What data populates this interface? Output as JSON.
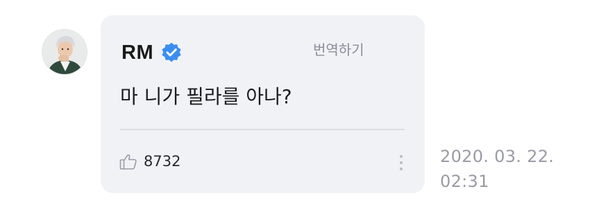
{
  "comment": {
    "author": "RM",
    "verified": true,
    "translate_label": "번역하기",
    "text": "마 니가 필라를 아나?",
    "likes": "8732",
    "date": "2020. 03. 22.",
    "time": "02:31"
  },
  "icons": {
    "avatar": "profile-photo",
    "verified": "verified-badge-icon",
    "like": "thumbs-up-icon",
    "more": "more-vertical-icon"
  },
  "colors": {
    "bubble_bg": "#f1f2f6",
    "verified_blue": "#3b8ef0",
    "muted_text": "#9a9ba4"
  }
}
